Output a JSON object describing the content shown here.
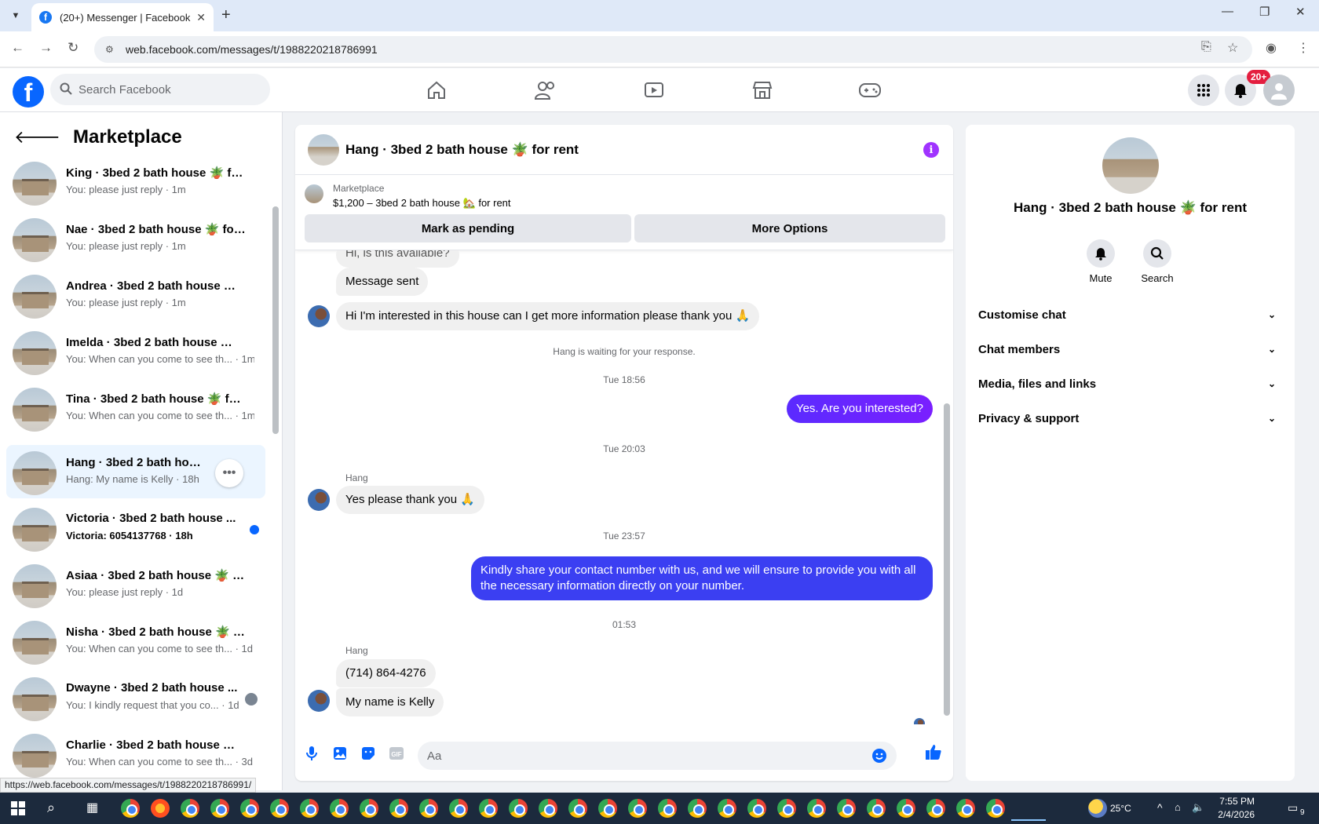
{
  "browser": {
    "tab_title": "(20+) Messenger | Facebook",
    "url": "web.facebook.com/messages/t/1988220218786991",
    "status_url": "https://web.facebook.com/messages/t/1988220218786991/"
  },
  "fb": {
    "search_placeholder": "Search Facebook",
    "notification_count": "20+"
  },
  "sidebar": {
    "title": "Marketplace",
    "conversations": [
      {
        "name": "King · 3bed 2 bath house 🪴 for ...",
        "preview": "You: please just reply · 1m"
      },
      {
        "name": "Nae · 3bed 2 bath house 🪴 for ...",
        "preview": "You: please just reply · 1m"
      },
      {
        "name": "Andrea · 3bed 2 bath house 🪴 f...",
        "preview": "You: please just reply · 1m"
      },
      {
        "name": "Imelda · 3bed 2 bath house 🪴 f...",
        "preview": "You: When can you come to see th... · 1m"
      },
      {
        "name": "Tina · 3bed 2 bath house 🪴 for ...",
        "preview": "You: When can you come to see th... · 1m"
      },
      {
        "name": "Hang · 3bed 2 bath house 🪴 ...",
        "preview": "Hang: My name is Kelly · 18h"
      },
      {
        "name": "Victoria · 3bed 2 bath house ...",
        "preview": "Victoria: 6054137768 · 18h"
      },
      {
        "name": "Asiaa · 3bed 2 bath house 🪴 for...",
        "preview": "You: please just reply · 1d"
      },
      {
        "name": "Nisha · 3bed 2 bath house 🪴 fo...",
        "preview": "You: When can you come to see th... · 1d"
      },
      {
        "name": "Dwayne · 3bed 2 bath house ...",
        "preview": "You: I kindly request that you co... · 1d"
      },
      {
        "name": "Charlie · 3bed 2 bath house 🪴 f...",
        "preview": "You: When can you come to see th... · 3d"
      }
    ]
  },
  "chat": {
    "title": "Hang · 3bed 2 bath house 🪴 for rent",
    "marketplace_label": "Marketplace",
    "listing": "$1,200 – 3bed 2 bath house 🏡 for rent",
    "mark_pending": "Mark as pending",
    "more_options": "More Options",
    "messages": {
      "partial": "Hi, is this available?",
      "m1": "Message sent",
      "m2": "Hi I'm interested in this house can I get more information please thank you 🙏",
      "waiting": "Hang is waiting for your response.",
      "t1": "Tue 18:56",
      "out1": "Yes. Are you interested?",
      "t2": "Tue 20:03",
      "sender1": "Hang",
      "m3": "Yes please thank you 🙏",
      "t3": "Tue 23:57",
      "out2": "Kindly share your contact number with us, and we will ensure to provide you with all the necessary information directly on your number.",
      "t4": "01:53",
      "sender2": "Hang",
      "m4": "(714) 864-4276",
      "m5": "My name is Kelly"
    },
    "composer_placeholder": "Aa"
  },
  "details": {
    "name": "Hang · 3bed 2 bath house 🪴 for rent",
    "mute": "Mute",
    "search": "Search",
    "rows": [
      "Customise chat",
      "Chat members",
      "Media, files and links",
      "Privacy & support"
    ]
  },
  "taskbar": {
    "temperature": "25°C",
    "time": "7:55 PM",
    "date": "2/4/2026",
    "notif": "9"
  },
  "colors": {
    "brand": "#0866ff",
    "outgoing_bubble": "#6a23ff",
    "info": "#a033ff"
  }
}
